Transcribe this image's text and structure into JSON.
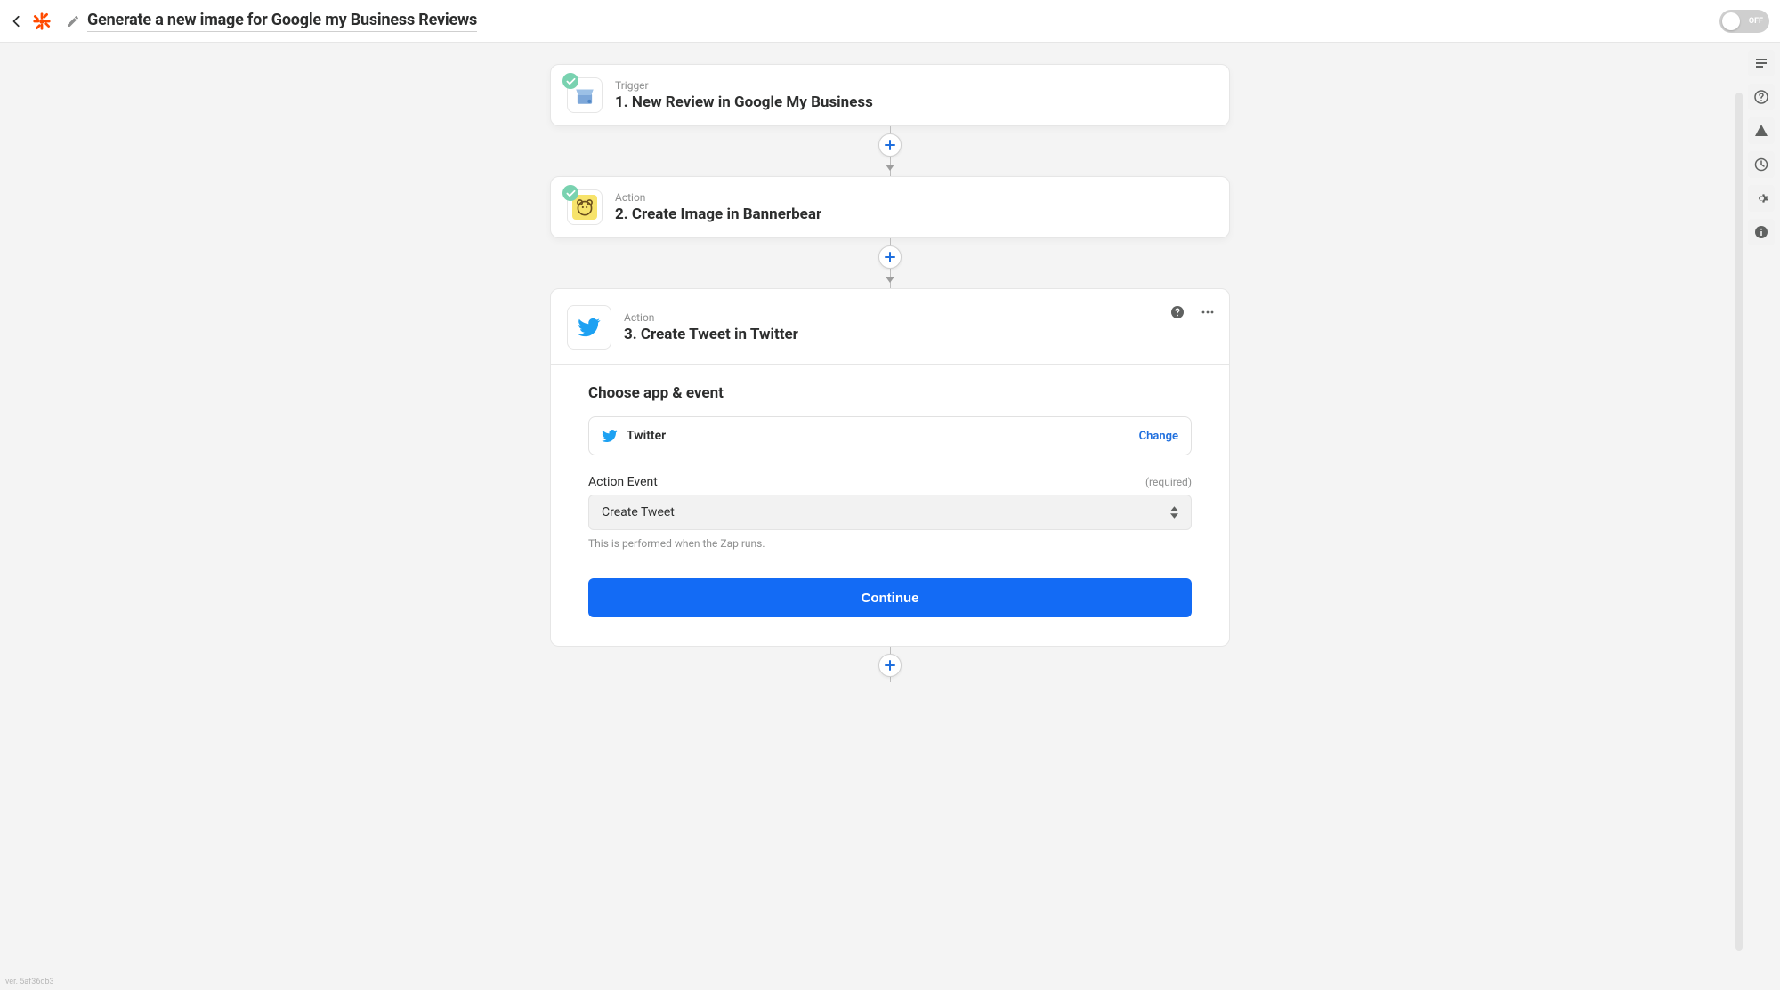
{
  "header": {
    "title": "Generate a new image for Google my Business Reviews",
    "toggle_state": "OFF"
  },
  "steps": {
    "trigger": {
      "kicker": "Trigger",
      "title": "1. New Review in Google My Business"
    },
    "action1": {
      "kicker": "Action",
      "title": "2. Create Image in Bannerbear"
    },
    "action2": {
      "kicker": "Action",
      "title": "3. Create Tweet in Twitter"
    }
  },
  "expanded": {
    "section_heading": "Choose app & event",
    "app_name": "Twitter",
    "change_label": "Change",
    "action_event_label": "Action Event",
    "required_label": "(required)",
    "action_event_value": "Create Tweet",
    "helper_text": "This is performed when the Zap runs.",
    "continue_label": "Continue"
  },
  "footer_version": "ver. 5af36db3"
}
